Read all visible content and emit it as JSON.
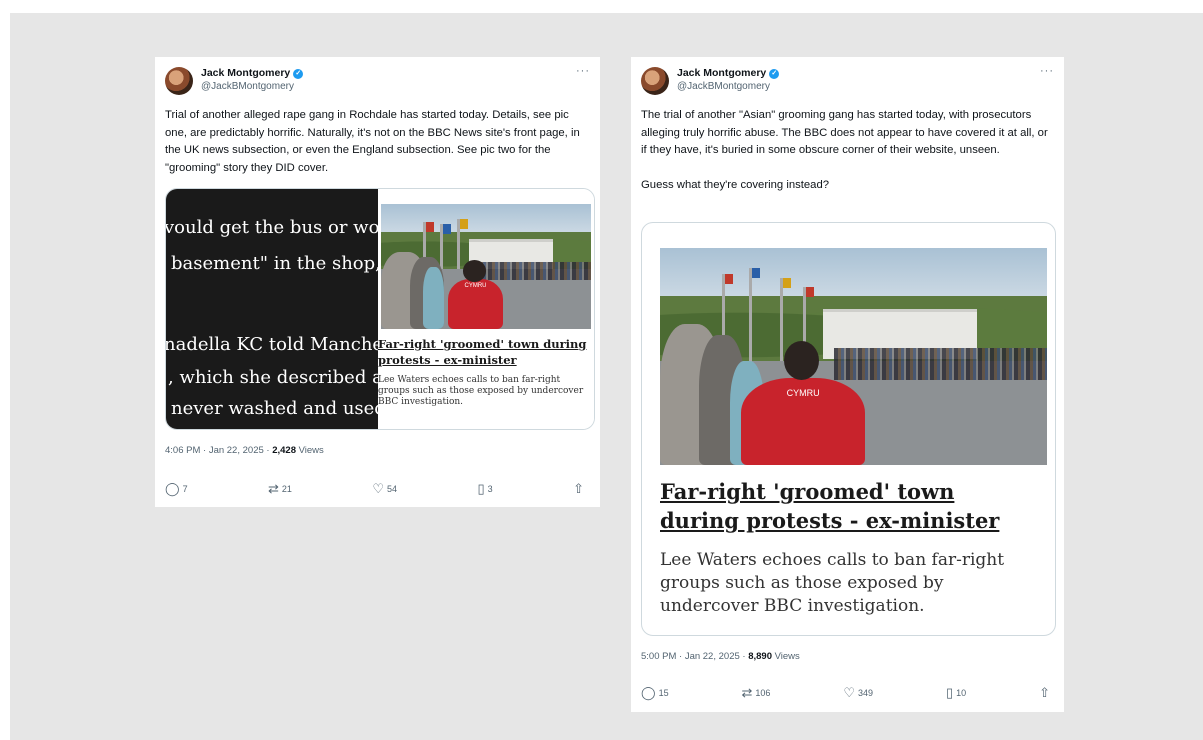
{
  "tweets": [
    {
      "author": "Jack Montgomery",
      "handle": "@JackBMontgomery",
      "more": "···",
      "text": "Trial of another alleged rape gang in Rochdale has started today. Details, see pic one, are predictably horrific. Naturally, it's not on the BBC News site's front page, in the UK news subsection, or even the England subsection. See pic two for the \"grooming\" story they DID cover.",
      "media": {
        "excerpt_lines": [
          "vould get the bus or woul",
          "basement\" in the shop, t",
          "nadella KC told Manchest",
          ", which she described as",
          "never washed and used f"
        ],
        "card_title": "Far-right 'groomed' town during protests - ex-minister",
        "card_desc": "Lee Waters echoes calls to ban far-right groups such as those exposed by undercover BBC investigation.",
        "shirt_text": "CYMRU"
      },
      "time": "4:06 PM · Jan 22, 2025 · ",
      "views": "2,428",
      "views_label": " Views",
      "replies": "7",
      "reposts": "21",
      "likes": "54",
      "bookmarks": "3"
    },
    {
      "author": "Jack Montgomery",
      "handle": "@JackBMontgomery",
      "more": "···",
      "text": "The trial of another \"Asian\" grooming gang has started today, with prosecutors alleging truly horrific abuse. The BBC does not appear to have covered it at all, or if they have, it's buried in some obscure corner of their website, unseen.\n\nGuess what they're covering instead?",
      "media": {
        "card_title": "Far-right 'groomed' town during protests - ex-minister",
        "card_desc": "Lee Waters echoes calls to ban far-right groups such as those exposed by undercover BBC investigation.",
        "shirt_text": "CYMRU"
      },
      "time": "5:00 PM · Jan 22, 2025 · ",
      "views": "8,890",
      "views_label": " Views",
      "replies": "15",
      "reposts": "106",
      "likes": "349",
      "bookmarks": "10"
    }
  ],
  "icons": {
    "verified": "verified-badge-icon",
    "reply": "reply-icon",
    "repost": "repost-icon",
    "like": "heart-icon",
    "bookmark": "bookmark-icon",
    "share": "share-icon"
  },
  "colors": {
    "background": "#e6e6e6",
    "verified": "#1d9bf0",
    "shirt": "#c8232c"
  }
}
